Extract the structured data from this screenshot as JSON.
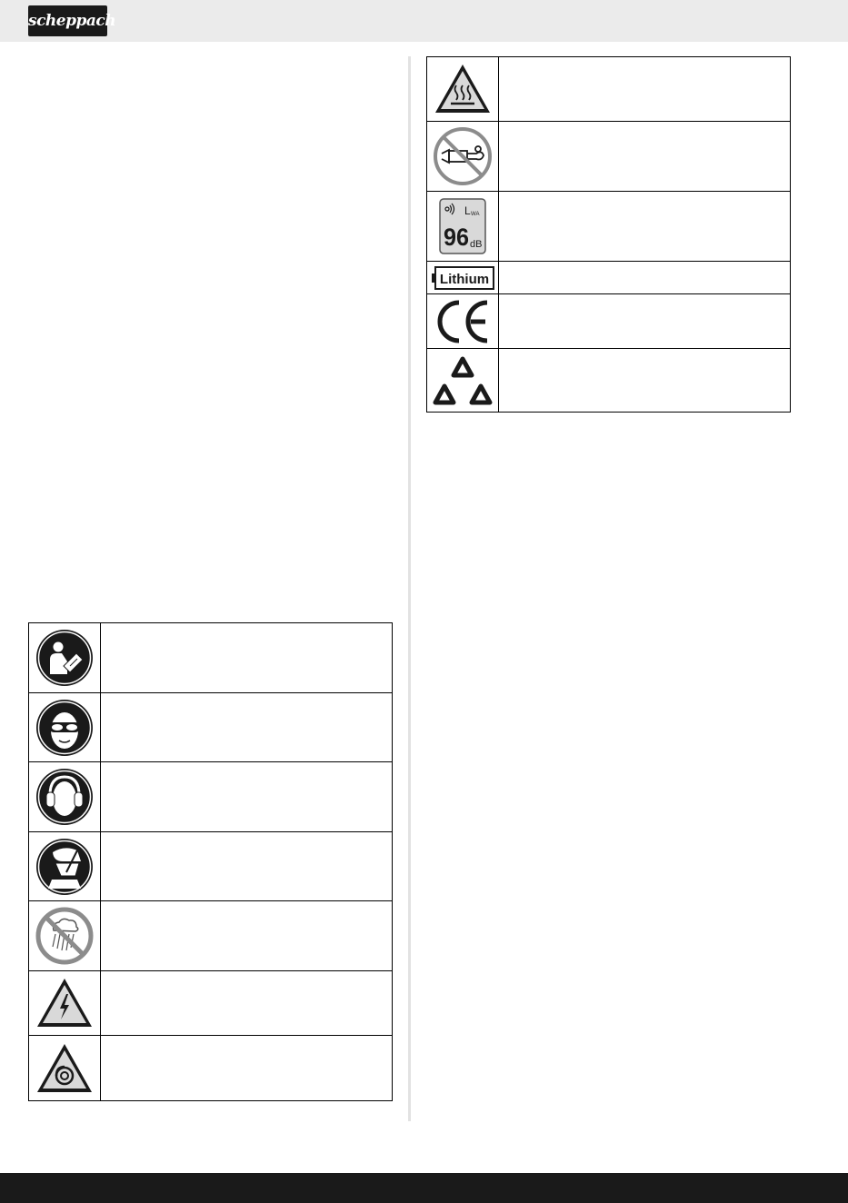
{
  "header": {
    "logo_text": "scheppach"
  },
  "colors": {
    "header_bg": "#ebebeb",
    "footer_bg": "#1a1a1a",
    "icon_black": "#1a1a1a",
    "warning_fill": "#d9d9d9",
    "prohibition_red": "#8c8c8c"
  },
  "left_symbols": [
    {
      "icon": "read-manual-icon",
      "text": ""
    },
    {
      "icon": "eye-protection-icon",
      "text": ""
    },
    {
      "icon": "ear-protection-icon",
      "text": ""
    },
    {
      "icon": "face-shield-icon",
      "text": ""
    },
    {
      "icon": "no-rain-icon",
      "text": ""
    },
    {
      "icon": "electric-shock-warning-icon",
      "text": ""
    },
    {
      "icon": "rotating-parts-warning-icon",
      "text": ""
    }
  ],
  "right_symbols": [
    {
      "icon": "hot-surface-warning-icon",
      "text": ""
    },
    {
      "icon": "no-fuel-icon",
      "text": ""
    },
    {
      "icon": "sound-power-level-icon",
      "text": ""
    },
    {
      "icon": "lithium-battery-icon",
      "text": ""
    },
    {
      "icon": "ce-mark-icon",
      "text": ""
    },
    {
      "icon": "recycling-icon",
      "text": ""
    }
  ],
  "sound_label": {
    "lwa": "L",
    "lwa_sub": "WA",
    "value": "96",
    "unit": "dB"
  },
  "battery_label": "Lithium",
  "ce_label": "CE"
}
